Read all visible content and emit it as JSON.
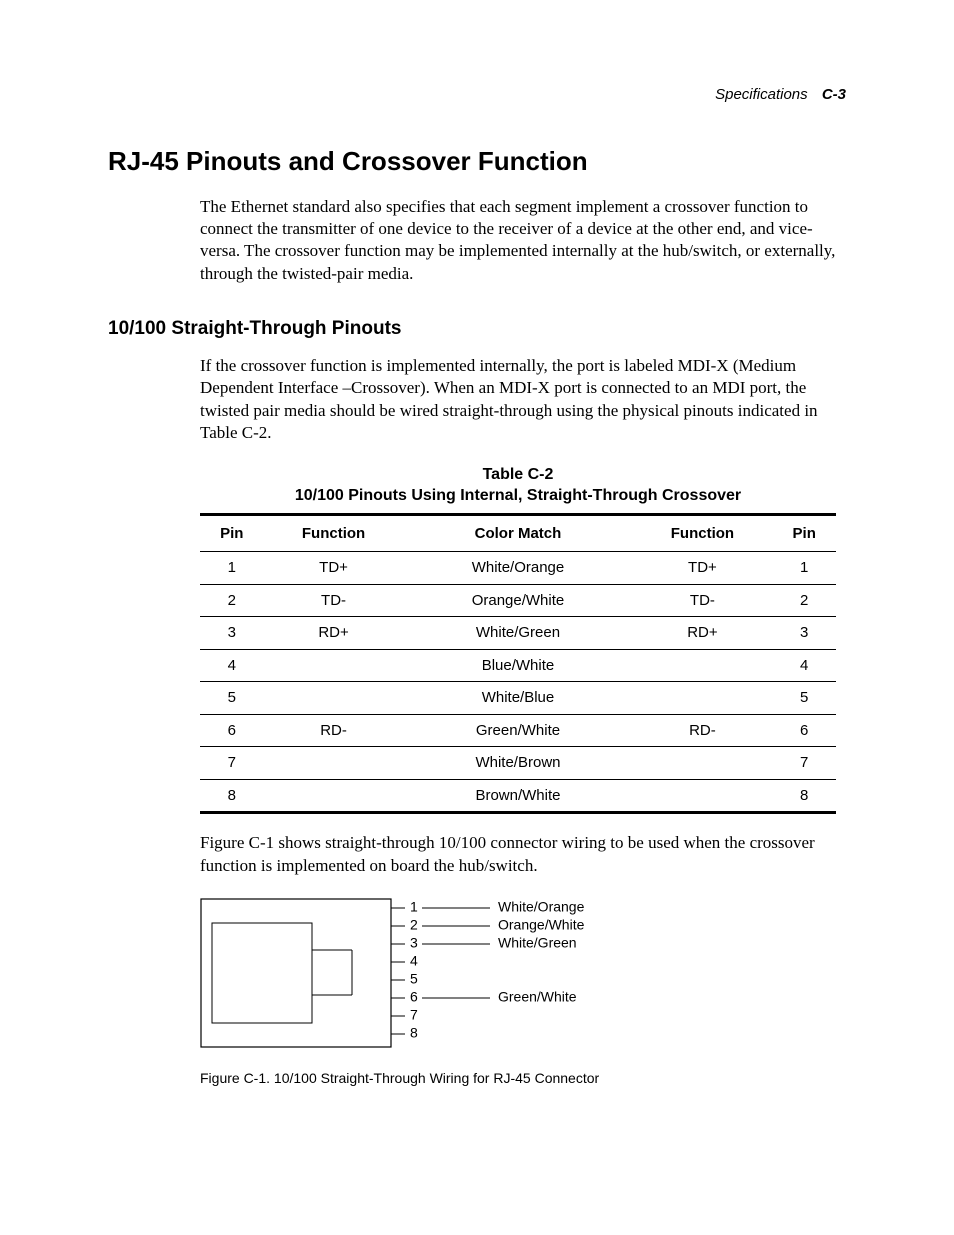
{
  "header": {
    "section": "Specifications",
    "page": "C-3"
  },
  "h1": "RJ-45 Pinouts and Crossover Function",
  "para1": "The Ethernet standard also specifies that each segment implement a crossover function to connect the transmitter of one device to the receiver of a device at the other end, and vice-versa. The crossover function may be implemented internally at the hub/switch, or externally, through the twisted-pair media.",
  "h2": "10/100 Straight-Through Pinouts",
  "para2": "If the crossover function is implemented internally, the port is labeled MDI-X (Medium Dependent Interface –Crossover). When an MDI-X port is connected to an MDI port, the twisted pair media should be wired straight-through using the physical pinouts indicated in Table C-2.",
  "table": {
    "num": "Table C-2",
    "title": "10/100 Pinouts Using Internal, Straight-Through Crossover",
    "headers": {
      "pinL": "Pin",
      "fnL": "Function",
      "color": "Color Match",
      "fnR": "Function",
      "pinR": "Pin"
    },
    "rows": [
      {
        "pinL": "1",
        "fnL": "TD+",
        "color": "White/Orange",
        "fnR": "TD+",
        "pinR": "1"
      },
      {
        "pinL": "2",
        "fnL": "TD-",
        "color": "Orange/White",
        "fnR": "TD-",
        "pinR": "2"
      },
      {
        "pinL": "3",
        "fnL": "RD+",
        "color": "White/Green",
        "fnR": "RD+",
        "pinR": "3"
      },
      {
        "pinL": "4",
        "fnL": "",
        "color": "Blue/White",
        "fnR": "",
        "pinR": "4"
      },
      {
        "pinL": "5",
        "fnL": "",
        "color": "White/Blue",
        "fnR": "",
        "pinR": "5"
      },
      {
        "pinL": "6",
        "fnL": "RD-",
        "color": "Green/White",
        "fnR": "RD-",
        "pinR": "6"
      },
      {
        "pinL": "7",
        "fnL": "",
        "color": "White/Brown",
        "fnR": "",
        "pinR": "7"
      },
      {
        "pinL": "8",
        "fnL": "",
        "color": "Brown/White",
        "fnR": "",
        "pinR": "8"
      }
    ]
  },
  "para3": "Figure C-1 shows straight-through 10/100 connector wiring to be used when the crossover function is implemented on board the hub/switch.",
  "figure": {
    "pins": [
      "1",
      "2",
      "3",
      "4",
      "5",
      "6",
      "7",
      "8"
    ],
    "labels": {
      "p1": "White/Orange",
      "p2": "Orange/White",
      "p3": "White/Green",
      "p6": "Green/White"
    },
    "caption": "Figure C-1.  10/100 Straight-Through Wiring for RJ-45 Connector"
  }
}
